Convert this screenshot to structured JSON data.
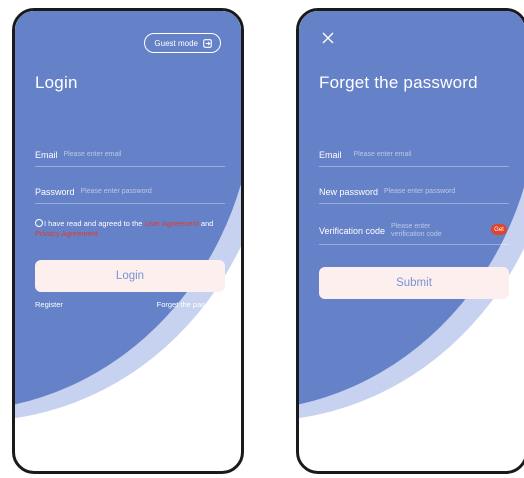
{
  "login": {
    "guest_mode": "Guest mode",
    "title": "Login",
    "email_label": "Email",
    "email_placeholder": "Please enter email",
    "password_label": "Password",
    "password_placeholder": "Please enter password",
    "agree_text": "I have read and agreed to the",
    "user_agreement": "User Agreement",
    "and": "and",
    "privacy_agreement": "Privacy Agreement",
    "login_button": "Login",
    "register": "Register",
    "forget_password": "Forget the password"
  },
  "forget": {
    "title": "Forget the password",
    "email_label": "Email",
    "email_placeholder": "Please enter email",
    "new_password_label": "New password",
    "new_password_placeholder": "Please enter password",
    "verification_label": "Verification code",
    "verification_placeholder": "Please enter verification code",
    "get_button": "Get",
    "submit_button": "Submit"
  },
  "colors": {
    "background_blue": "#6581c8",
    "arc_light": "#c7d2f0",
    "button_fill": "#fcefee",
    "link_red": "#e23b2e",
    "get_badge": "#e0452e"
  },
  "icons": [
    "exit-icon",
    "close-icon",
    "radio-icon"
  ]
}
